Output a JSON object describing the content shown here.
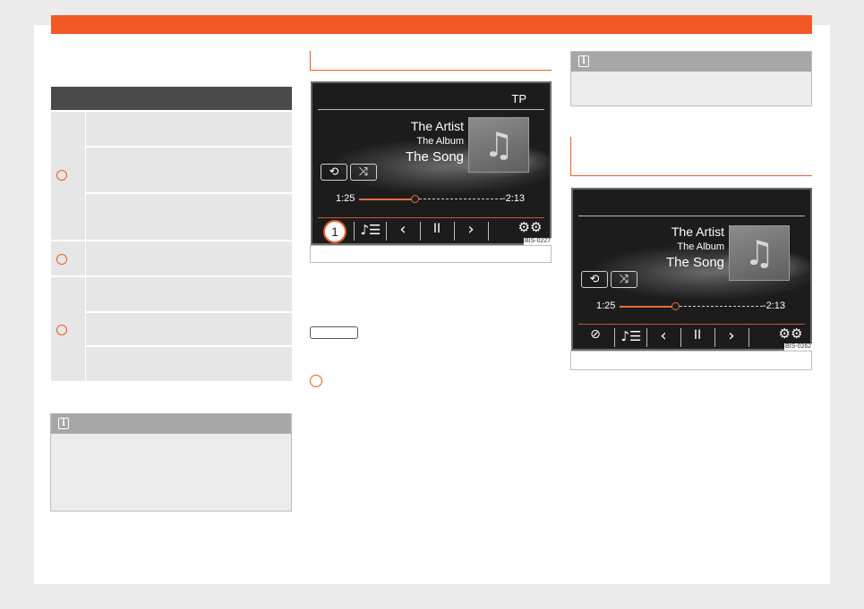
{
  "screen_left": {
    "tp_label": "TP",
    "artist": "The Artist",
    "album": "The Album",
    "song": "The Song",
    "elapsed": "1:25",
    "remaining": "-2:13",
    "progress": 0.39,
    "callout_number": "1",
    "figure_code": "BIS-0227"
  },
  "screen_right": {
    "artist": "The Artist",
    "album": "The Album",
    "song": "The Song",
    "elapsed": "1:25",
    "remaining": "-2:13",
    "progress": 0.39,
    "figure_code": "BIS-0262"
  },
  "colors": {
    "accent": "#f15a24",
    "table_header": "#4a4a4a",
    "cell_bg": "#e6e6e6",
    "note_header": "#a7a7a7"
  },
  "icons": [
    "info-icon",
    "repeat-icon",
    "shuffle-icon",
    "music-note-icon",
    "playlist-icon",
    "previous-icon",
    "pause-icon",
    "next-icon",
    "settings-icon",
    "compass-icon"
  ]
}
